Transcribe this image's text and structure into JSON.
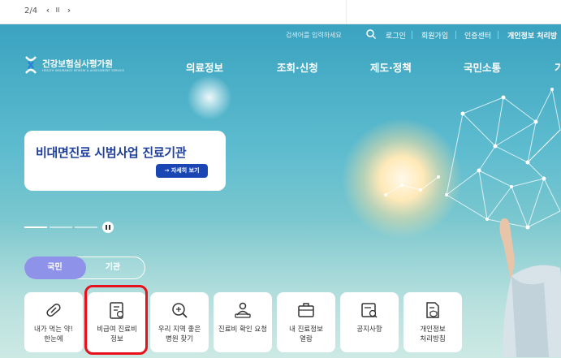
{
  "topbar": {
    "pager": "2/4",
    "prev": "‹",
    "pause": "II",
    "next": "›"
  },
  "utility": {
    "search_placeholder": "검색어를 입력하세요",
    "items": [
      "로그인",
      "회원가입",
      "인증센터",
      "개인정보 처리방"
    ]
  },
  "logo": {
    "title": "건강보험심사평가원",
    "subtitle": "HEALTH INSURANCE REVIEW & ASSESSMENT SERVICE"
  },
  "nav": [
    "의료정보",
    "조회·신청",
    "제도·정책",
    "국민소통",
    "기"
  ],
  "banner": {
    "title": "비대면진료 시범사업 진료기관",
    "button": "→ 자세히 보기"
  },
  "toggle": {
    "active": "국민",
    "other": "기관"
  },
  "cards": [
    {
      "icon": "pill-icon",
      "line1": "내가 먹는 약!",
      "line2": "한눈에"
    },
    {
      "icon": "price-document-icon",
      "line1": "비급여 진료비",
      "line2": "정보"
    },
    {
      "icon": "hospital-search-icon",
      "line1": "우리 지역 좋은",
      "line2": "병원 찾기"
    },
    {
      "icon": "person-laptop-icon",
      "line1": "진료비 확인 요청",
      "line2": ""
    },
    {
      "icon": "briefcase-icon",
      "line1": "내 진료정보",
      "line2": "열람"
    },
    {
      "icon": "notice-search-icon",
      "line1": "공지사항",
      "line2": ""
    },
    {
      "icon": "privacy-document-icon",
      "line1": "개인정보",
      "line2": "처리방침"
    }
  ],
  "colors": {
    "brand_blue": "#1e3f9c",
    "button_blue": "#1a46b3",
    "toggle_active": "#8e92e8",
    "highlight": "#e8101a"
  }
}
